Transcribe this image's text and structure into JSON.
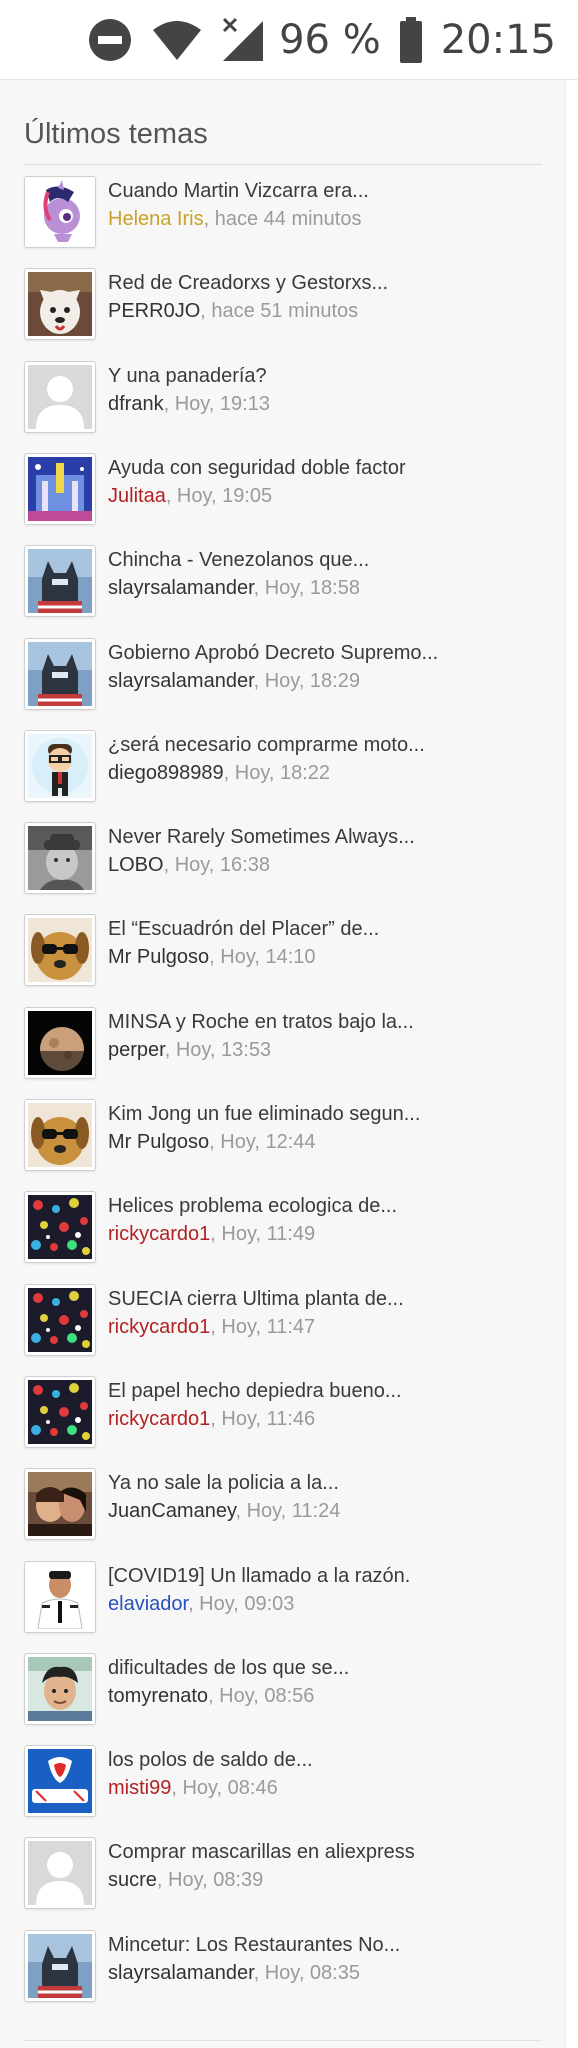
{
  "statusbar": {
    "battery_pct": "96 %",
    "time": "20:15",
    "icons": [
      "do-not-disturb-icon",
      "wifi-icon",
      "no-signal-icon",
      "battery-icon"
    ]
  },
  "section": {
    "title": "Últimos temas"
  },
  "topics": [
    {
      "title": "Cuando Martin Vizcarra era...",
      "author": "Helena Iris",
      "time": ", hace 44 minutos",
      "author_color": "#c9a227",
      "avatar": "pony"
    },
    {
      "title": "Red de Creadorxs y Gestorxs...",
      "author": "PERR0JO",
      "time": ", hace 51 minutos",
      "author_color": "#333333",
      "avatar": "dog-white"
    },
    {
      "title": "Y una panadería?",
      "author": "dfrank",
      "time": ", Hoy, 19:13",
      "author_color": "#333333",
      "avatar": "default"
    },
    {
      "title": "Ayuda con seguridad doble factor",
      "author": "Julitaa",
      "time": ", Hoy, 19:05",
      "author_color": "#b22222",
      "avatar": "castle"
    },
    {
      "title": "Chincha - Venezolanos que...",
      "author": "slayrsalamander",
      "time": ", Hoy, 18:58",
      "author_color": "#333333",
      "avatar": "batman"
    },
    {
      "title": "Gobierno Aprobó Decreto Supremo...",
      "author": "slayrsalamander",
      "time": ", Hoy, 18:29",
      "author_color": "#333333",
      "avatar": "batman"
    },
    {
      "title": "¿será necesario comprarme moto...",
      "author": "diego898989",
      "time": ", Hoy, 18:22",
      "author_color": "#333333",
      "avatar": "cartoon"
    },
    {
      "title": "Never Rarely Sometimes Always...",
      "author": "LOBO",
      "time": ", Hoy, 16:38",
      "author_color": "#333333",
      "avatar": "bw-man"
    },
    {
      "title": "El “Escuadrón del Placer” de...",
      "author": "Mr Pulgoso",
      "time": ", Hoy, 14:10",
      "author_color": "#333333",
      "avatar": "dog-glasses"
    },
    {
      "title": "MINSA y Roche en tratos bajo la...",
      "author": "perper",
      "time": ", Hoy, 13:53",
      "author_color": "#333333",
      "avatar": "moon"
    },
    {
      "title": "Kim Jong un fue eliminado segun...",
      "author": "Mr Pulgoso",
      "time": ", Hoy, 12:44",
      "author_color": "#333333",
      "avatar": "dog-glasses"
    },
    {
      "title": "Helices problema ecologica de...",
      "author": "rickycardo1",
      "time": ", Hoy, 11:49",
      "author_color": "#b22222",
      "avatar": "pattern"
    },
    {
      "title": "SUECIA cierra Ultima planta de...",
      "author": "rickycardo1",
      "time": ", Hoy, 11:47",
      "author_color": "#b22222",
      "avatar": "pattern"
    },
    {
      "title": "El papel hecho depiedra bueno...",
      "author": "rickycardo1",
      "time": ", Hoy, 11:46",
      "author_color": "#b22222",
      "avatar": "pattern"
    },
    {
      "title": "Ya no sale la policia a la...",
      "author": "JuanCamaney",
      "time": ", Hoy, 11:24",
      "author_color": "#333333",
      "avatar": "couple"
    },
    {
      "title": "[COVID19] Un llamado a la razón.",
      "author": "elaviador",
      "time": ", Hoy, 09:03",
      "author_color": "#2a52be",
      "avatar": "pilot"
    },
    {
      "title": "dificultades de los que se...",
      "author": "tomyrenato",
      "time": ", Hoy, 08:56",
      "author_color": "#333333",
      "avatar": "selfie"
    },
    {
      "title": "los polos de saldo de...",
      "author": "misti99",
      "time": ", Hoy, 08:46",
      "author_color": "#b22222",
      "avatar": "logo-blue"
    },
    {
      "title": "Comprar mascarillas en aliexpress",
      "author": "sucre",
      "time": ", Hoy, 08:39",
      "author_color": "#333333",
      "avatar": "default"
    },
    {
      "title": "Mincetur: Los Restaurantes No...",
      "author": "slayrsalamander",
      "time": ", Hoy, 08:35",
      "author_color": "#333333",
      "avatar": "batman"
    }
  ]
}
